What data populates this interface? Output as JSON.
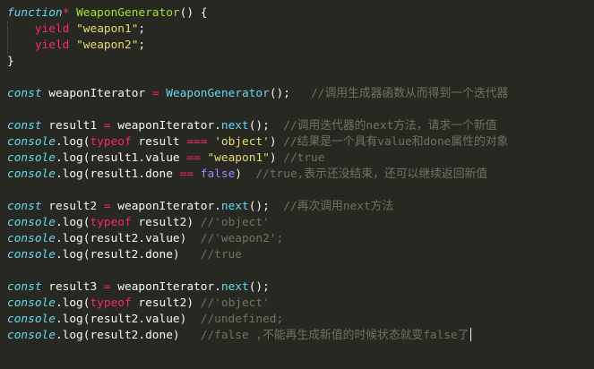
{
  "colors": {
    "background": "#272822",
    "plain": "#f8f8f2",
    "keyword": "#66d9ef",
    "storage": "#f92672",
    "string": "#e6db74",
    "function": "#a6e22e",
    "comment": "#75715e",
    "constant": "#ae81ff",
    "special": "#fd971f"
  },
  "code_lines": [
    [
      {
        "t": "function",
        "c": "keyword",
        "i": true
      },
      {
        "t": "* ",
        "c": "storage"
      },
      {
        "t": "WeaponGenerator",
        "c": "function"
      },
      {
        "t": "() {",
        "c": "plain"
      }
    ],
    [
      {
        "t": "    ",
        "c": "plain"
      },
      {
        "t": "yield",
        "c": "storage"
      },
      {
        "t": " ",
        "c": "plain"
      },
      {
        "t": "\"weapon1\"",
        "c": "string"
      },
      {
        "t": ";",
        "c": "plain"
      }
    ],
    [
      {
        "t": "    ",
        "c": "plain"
      },
      {
        "t": "yield",
        "c": "storage"
      },
      {
        "t": " ",
        "c": "plain"
      },
      {
        "t": "\"weapon2\"",
        "c": "string"
      },
      {
        "t": ";",
        "c": "plain"
      }
    ],
    [
      {
        "t": "}",
        "c": "plain"
      }
    ],
    [],
    [
      {
        "t": "const",
        "c": "keyword",
        "i": true
      },
      {
        "t": " weaponIterator ",
        "c": "plain"
      },
      {
        "t": "=",
        "c": "storage"
      },
      {
        "t": " ",
        "c": "plain"
      },
      {
        "t": "WeaponGenerator",
        "c": "keyword"
      },
      {
        "t": "();   ",
        "c": "plain"
      },
      {
        "t": "//调用生成器函数从而得到一个迭代器",
        "c": "comment"
      }
    ],
    [],
    [
      {
        "t": "const",
        "c": "keyword",
        "i": true
      },
      {
        "t": " result1 ",
        "c": "plain"
      },
      {
        "t": "=",
        "c": "storage"
      },
      {
        "t": " weaponIterator.",
        "c": "plain"
      },
      {
        "t": "next",
        "c": "keyword"
      },
      {
        "t": "();  ",
        "c": "plain"
      },
      {
        "t": "//调用迭代器的next方法，请求一个新值",
        "c": "comment"
      }
    ],
    [
      {
        "t": "console",
        "c": "keyword",
        "i": true
      },
      {
        "t": ".log(",
        "c": "plain"
      },
      {
        "t": "typeof",
        "c": "storage"
      },
      {
        "t": " result ",
        "c": "plain"
      },
      {
        "t": "===",
        "c": "storage"
      },
      {
        "t": " ",
        "c": "plain"
      },
      {
        "t": "'object'",
        "c": "string"
      },
      {
        "t": ") ",
        "c": "plain"
      },
      {
        "t": "//结果是一个具有value和done属性的对象",
        "c": "comment"
      }
    ],
    [
      {
        "t": "console",
        "c": "keyword",
        "i": true
      },
      {
        "t": ".log(result1.value ",
        "c": "plain"
      },
      {
        "t": "==",
        "c": "storage"
      },
      {
        "t": " ",
        "c": "plain"
      },
      {
        "t": "\"weapon1\"",
        "c": "string"
      },
      {
        "t": ") ",
        "c": "plain"
      },
      {
        "t": "//true",
        "c": "comment"
      }
    ],
    [
      {
        "t": "console",
        "c": "keyword",
        "i": true
      },
      {
        "t": ".log(result1.done ",
        "c": "plain"
      },
      {
        "t": "==",
        "c": "storage"
      },
      {
        "t": " ",
        "c": "plain"
      },
      {
        "t": "false",
        "c": "constant"
      },
      {
        "t": ")  ",
        "c": "plain"
      },
      {
        "t": "//true,表示还没结束，还可以继续返回新值",
        "c": "comment"
      }
    ],
    [],
    [
      {
        "t": "const",
        "c": "keyword",
        "i": true
      },
      {
        "t": " result2 ",
        "c": "plain"
      },
      {
        "t": "=",
        "c": "storage"
      },
      {
        "t": " weaponIterator.",
        "c": "plain"
      },
      {
        "t": "next",
        "c": "keyword"
      },
      {
        "t": "();  ",
        "c": "plain"
      },
      {
        "t": "//再次调用next方法",
        "c": "comment"
      }
    ],
    [
      {
        "t": "console",
        "c": "keyword",
        "i": true
      },
      {
        "t": ".log(",
        "c": "plain"
      },
      {
        "t": "typeof",
        "c": "storage"
      },
      {
        "t": " result2) ",
        "c": "plain"
      },
      {
        "t": "//'object'",
        "c": "comment"
      }
    ],
    [
      {
        "t": "console",
        "c": "keyword",
        "i": true
      },
      {
        "t": ".log(result2.value)  ",
        "c": "plain"
      },
      {
        "t": "//'weapon2';",
        "c": "comment"
      }
    ],
    [
      {
        "t": "console",
        "c": "keyword",
        "i": true
      },
      {
        "t": ".log(result2.done)   ",
        "c": "plain"
      },
      {
        "t": "//true",
        "c": "comment"
      }
    ],
    [],
    [
      {
        "t": "const",
        "c": "keyword",
        "i": true
      },
      {
        "t": " result3 ",
        "c": "plain"
      },
      {
        "t": "=",
        "c": "storage"
      },
      {
        "t": " weaponIterator.",
        "c": "plain"
      },
      {
        "t": "next",
        "c": "keyword"
      },
      {
        "t": "();",
        "c": "plain"
      }
    ],
    [
      {
        "t": "console",
        "c": "keyword",
        "i": true
      },
      {
        "t": ".log(",
        "c": "plain"
      },
      {
        "t": "typeof",
        "c": "storage"
      },
      {
        "t": " result2) ",
        "c": "plain"
      },
      {
        "t": "//'object'",
        "c": "comment"
      }
    ],
    [
      {
        "t": "console",
        "c": "keyword",
        "i": true
      },
      {
        "t": ".log(result2.value)  ",
        "c": "plain"
      },
      {
        "t": "//undefined;",
        "c": "comment"
      }
    ],
    [
      {
        "t": "console",
        "c": "keyword",
        "i": true
      },
      {
        "t": ".log(result2.done)   ",
        "c": "plain"
      },
      {
        "t": "//false ,不能再生成新值的时候状态就变false了",
        "c": "comment"
      }
    ]
  ]
}
